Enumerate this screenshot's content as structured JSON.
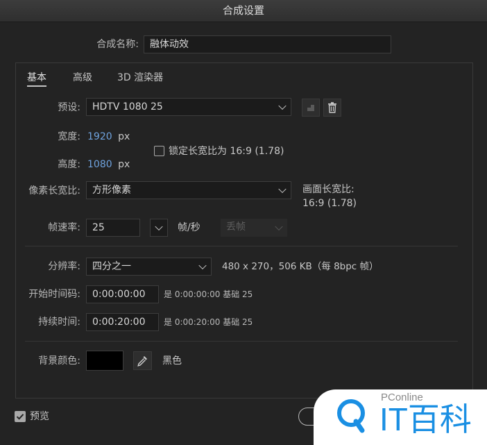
{
  "window": {
    "title": "合成设置"
  },
  "name": {
    "label": "合成名称:",
    "value": "融体动效"
  },
  "tabs": [
    {
      "label": "基本"
    },
    {
      "label": "高级"
    },
    {
      "label": "3D 渲染器"
    }
  ],
  "preset": {
    "label": "预设:",
    "value": "HDTV 1080 25"
  },
  "width": {
    "label": "宽度:",
    "value": "1920",
    "unit": "px"
  },
  "height": {
    "label": "高度:",
    "value": "1080",
    "unit": "px"
  },
  "lock_ratio": {
    "label": "锁定长宽比为 16:9 (1.78)",
    "checked": false
  },
  "pixel_aspect": {
    "label": "像素长宽比:",
    "value": "方形像素"
  },
  "frame_aspect": {
    "label": "画面长宽比:",
    "value": "16:9 (1.78)"
  },
  "frame_rate": {
    "label": "帧速率:",
    "value": "25",
    "unit": "帧/秒",
    "drop_frame": "丢帧"
  },
  "resolution": {
    "label": "分辨率:",
    "value": "四分之一",
    "info": "480 x 270，506 KB（每 8bpc 帧）"
  },
  "start_timecode": {
    "label": "开始时间码:",
    "value": "0:00:00:00",
    "info": "是 0:00:00:00  基础 25"
  },
  "duration": {
    "label": "持续时间:",
    "value": "0:00:20:00",
    "info": "是 0:00:20:00  基础 25"
  },
  "background": {
    "label": "背景颜色:",
    "color": "#000000",
    "color_name": "黑色"
  },
  "preview": {
    "label": "预览",
    "checked": true
  },
  "watermark": {
    "brand_small": "PConline",
    "brand_large": "IT百科"
  },
  "colors": {
    "accent_blue": "#6fa3df",
    "watermark_blue": "#1a8fe3"
  }
}
